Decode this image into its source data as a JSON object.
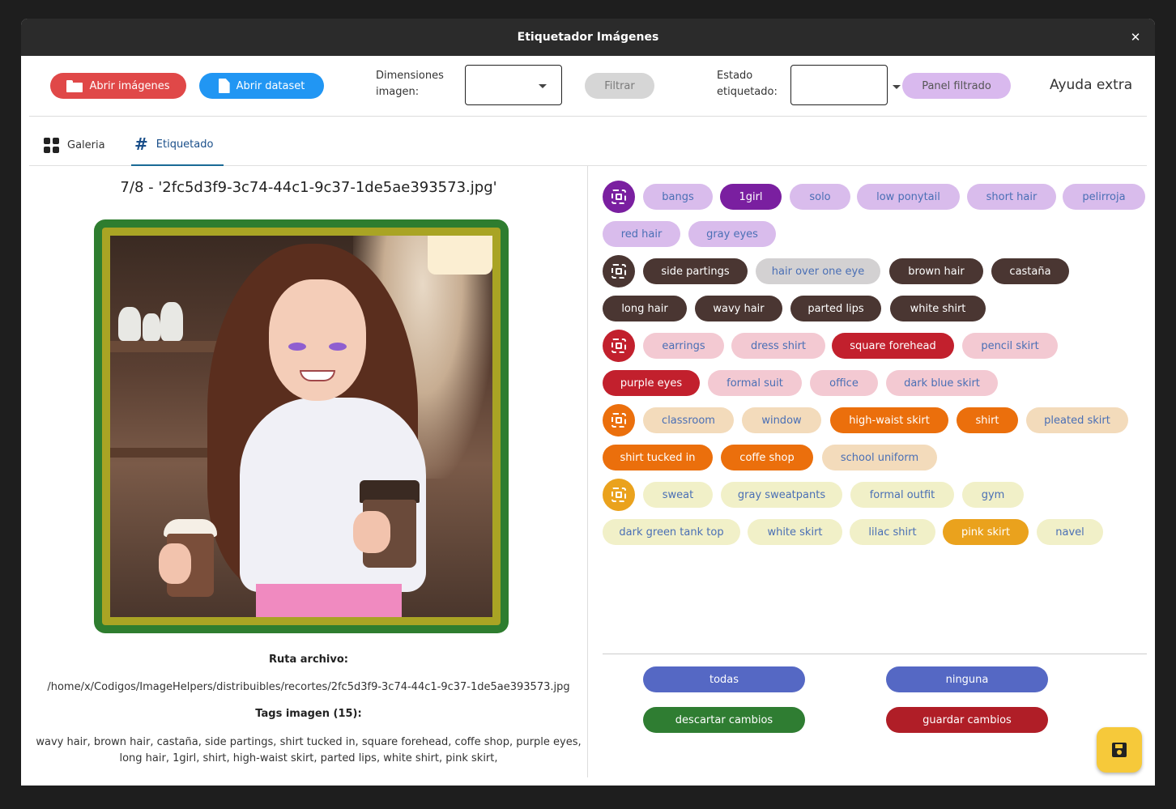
{
  "window": {
    "title": "Etiquetador Imágenes",
    "close_glyph": "✕"
  },
  "toolbar": {
    "open_images_label": "Abrir imágenes",
    "open_dataset_label": "Abrir dataset",
    "dimensions_label": "Dimensiones imagen:",
    "dimensions_value": "",
    "filter_label": "Filtrar",
    "state_label": "Estado etiquetado:",
    "state_value": "",
    "filter_panel_label": "Panel filtrado",
    "help_label": "Ayuda extra"
  },
  "tabs": [
    {
      "label": "Galeria",
      "icon": "grid-icon",
      "active": false
    },
    {
      "label": "Etiquetado",
      "icon": "hash-icon",
      "active": true
    }
  ],
  "image": {
    "title": "7/8 - '2fc5d3f9-3c74-44c1-9c37-1de5ae393573.jpg'",
    "path_label": "Ruta archivo:",
    "path_value": "/home/x/Codigos/ImageHelpers/distribuibles/recortes/2fc5d3f9-3c74-44c1-9c37-1de5ae393573.jpg",
    "tags_label": "Tags imagen (15):",
    "tags_value": "wavy hair, brown hair, castaña, side partings, shirt tucked in, square forehead, coffe shop, purple eyes, long hair, 1girl, shirt, high-waist skirt, parted lips, white shirt, pink skirt,",
    "frame_colors": {
      "outer": "#2e7d2f",
      "inner": "#a9a424"
    }
  },
  "tag_groups": [
    {
      "color": "#7a1fa0",
      "tags": [
        {
          "label": "bangs",
          "selected": false
        },
        {
          "label": "1girl",
          "selected": true
        },
        {
          "label": "solo",
          "selected": false
        },
        {
          "label": "low ponytail",
          "selected": false
        },
        {
          "label": "short hair",
          "selected": false
        },
        {
          "label": "pelirroja",
          "selected": false
        },
        {
          "label": "red hair",
          "selected": false
        },
        {
          "label": "gray eyes",
          "selected": false
        }
      ]
    },
    {
      "color": "#4a3632",
      "tags": [
        {
          "label": "side partings",
          "selected": true
        },
        {
          "label": "hair over one eye",
          "selected": false
        },
        {
          "label": "brown hair",
          "selected": true
        },
        {
          "label": "castaña",
          "selected": true
        },
        {
          "label": "long hair",
          "selected": true
        },
        {
          "label": "wavy hair",
          "selected": true
        },
        {
          "label": "parted lips",
          "selected": true
        },
        {
          "label": "white shirt",
          "selected": true
        }
      ]
    },
    {
      "color": "#c2202d",
      "tags": [
        {
          "label": "earrings",
          "selected": false
        },
        {
          "label": "dress shirt",
          "selected": false
        },
        {
          "label": "square forehead",
          "selected": true
        },
        {
          "label": "pencil skirt",
          "selected": false
        },
        {
          "label": "purple eyes",
          "selected": true
        },
        {
          "label": "formal suit",
          "selected": false
        },
        {
          "label": "office",
          "selected": false
        },
        {
          "label": "dark blue skirt",
          "selected": false
        }
      ]
    },
    {
      "color": "#eb6f0c",
      "tags": [
        {
          "label": "classroom",
          "selected": false
        },
        {
          "label": "window",
          "selected": false
        },
        {
          "label": "high-waist skirt",
          "selected": true
        },
        {
          "label": "shirt",
          "selected": true
        },
        {
          "label": "pleated skirt",
          "selected": false
        },
        {
          "label": "shirt tucked in",
          "selected": true
        },
        {
          "label": "coffe shop",
          "selected": true
        },
        {
          "label": "school uniform",
          "selected": false
        }
      ]
    },
    {
      "color": "#eaa21d",
      "tags": [
        {
          "label": "sweat",
          "selected": false
        },
        {
          "label": "gray sweatpants",
          "selected": false
        },
        {
          "label": "formal outfit",
          "selected": false
        },
        {
          "label": "gym",
          "selected": false
        },
        {
          "label": "dark green tank top",
          "selected": false
        },
        {
          "label": "white skirt",
          "selected": false
        },
        {
          "label": "lilac shirt",
          "selected": false
        },
        {
          "label": "pink skirt",
          "selected": true
        },
        {
          "label": "navel",
          "selected": false
        }
      ]
    }
  ],
  "actions": {
    "all_label": "todas",
    "none_label": "ninguna",
    "discard_label": "descartar cambios",
    "save_label": "guardar cambios"
  },
  "fab": {
    "icon": "save-icon"
  }
}
